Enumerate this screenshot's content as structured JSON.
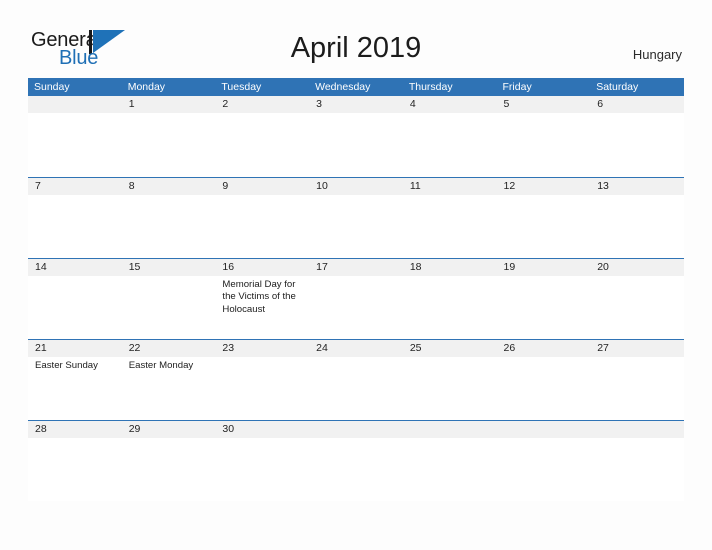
{
  "brand": {
    "name_part1": "General",
    "name_part2": "Blue",
    "mark": "triangle-logo-icon",
    "color_dark": "#17181a",
    "color_blue": "#1f72b8"
  },
  "header": {
    "title": "April 2019",
    "region": "Hungary"
  },
  "calendar": {
    "accent_color": "#2f73b5",
    "number_band_color": "#f1f1f1",
    "weekdays": [
      "Sunday",
      "Monday",
      "Tuesday",
      "Wednesday",
      "Thursday",
      "Friday",
      "Saturday"
    ],
    "weeks": [
      {
        "days": [
          {
            "num": "",
            "event": ""
          },
          {
            "num": "1",
            "event": ""
          },
          {
            "num": "2",
            "event": ""
          },
          {
            "num": "3",
            "event": ""
          },
          {
            "num": "4",
            "event": ""
          },
          {
            "num": "5",
            "event": ""
          },
          {
            "num": "6",
            "event": ""
          }
        ]
      },
      {
        "days": [
          {
            "num": "7",
            "event": ""
          },
          {
            "num": "8",
            "event": ""
          },
          {
            "num": "9",
            "event": ""
          },
          {
            "num": "10",
            "event": ""
          },
          {
            "num": "11",
            "event": ""
          },
          {
            "num": "12",
            "event": ""
          },
          {
            "num": "13",
            "event": ""
          }
        ]
      },
      {
        "days": [
          {
            "num": "14",
            "event": ""
          },
          {
            "num": "15",
            "event": ""
          },
          {
            "num": "16",
            "event": "Memorial Day for the Victims of the Holocaust"
          },
          {
            "num": "17",
            "event": ""
          },
          {
            "num": "18",
            "event": ""
          },
          {
            "num": "19",
            "event": ""
          },
          {
            "num": "20",
            "event": ""
          }
        ]
      },
      {
        "days": [
          {
            "num": "21",
            "event": "Easter Sunday"
          },
          {
            "num": "22",
            "event": "Easter Monday"
          },
          {
            "num": "23",
            "event": ""
          },
          {
            "num": "24",
            "event": ""
          },
          {
            "num": "25",
            "event": ""
          },
          {
            "num": "26",
            "event": ""
          },
          {
            "num": "27",
            "event": ""
          }
        ]
      },
      {
        "days": [
          {
            "num": "28",
            "event": ""
          },
          {
            "num": "29",
            "event": ""
          },
          {
            "num": "30",
            "event": ""
          },
          {
            "num": "",
            "event": ""
          },
          {
            "num": "",
            "event": ""
          },
          {
            "num": "",
            "event": ""
          },
          {
            "num": "",
            "event": ""
          }
        ]
      }
    ]
  }
}
